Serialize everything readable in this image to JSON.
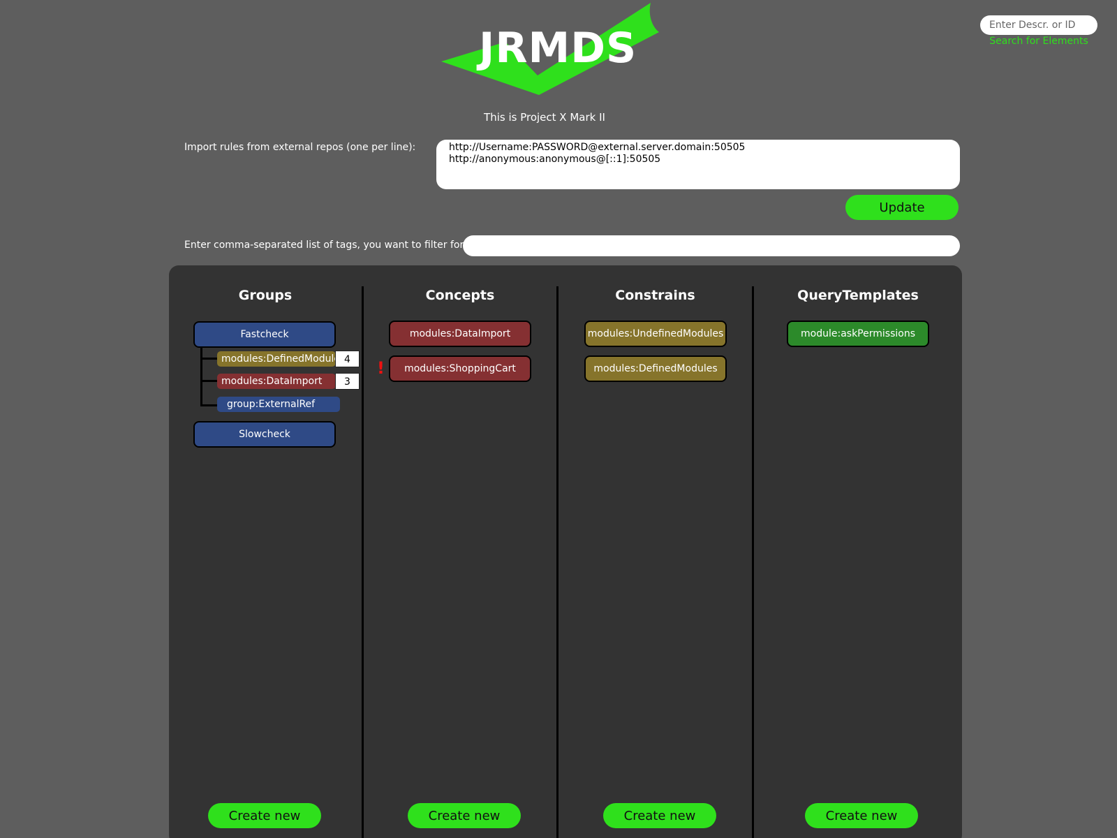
{
  "brand": {
    "logo_text": "JRMDS",
    "accent_color": "#2fe01c"
  },
  "search": {
    "placeholder": "Enter Descr. or ID",
    "link_label": "Search for Elements"
  },
  "subtitle": "This is Project X Mark II",
  "repos": {
    "label": "Import rules from external repos (one per line):",
    "value": "http://Username:PASSWORD@external.server.domain:50505\nhttp://anonymous:anonymous@[::1]:50505",
    "update_label": "Update"
  },
  "tags": {
    "label": "Enter comma-separated list of tags, you want to filter for:",
    "value": ""
  },
  "columns": {
    "groups": {
      "title": "Groups",
      "items": [
        {
          "label": "Fastcheck",
          "color": "#2f4a86"
        },
        {
          "label": "Slowcheck",
          "color": "#2f4a86"
        }
      ],
      "children": [
        {
          "label": "modules:DefinedModules",
          "count": "4",
          "color": "#86742b"
        },
        {
          "label": "modules:DataImport",
          "count": "3",
          "color": "#853032"
        },
        {
          "label": "group:ExternalRef",
          "color": "#2f4a86"
        }
      ],
      "create_label": "Create new"
    },
    "concepts": {
      "title": "Concepts",
      "items": [
        {
          "label": "modules:DataImport",
          "color": "#853032"
        },
        {
          "label": "modules:ShoppingCart",
          "color": "#853032",
          "warning": "!"
        }
      ],
      "create_label": "Create new"
    },
    "constraints": {
      "title": "Constrains",
      "items": [
        {
          "label": "modules:UndefinedModules",
          "color": "#86742b"
        },
        {
          "label": "modules:DefinedModules",
          "color": "#86742b"
        }
      ],
      "create_label": "Create new"
    },
    "querytemplates": {
      "title": "QueryTemplates",
      "items": [
        {
          "label": "module:askPermissions",
          "color": "#2c8a2a"
        }
      ],
      "create_label": "Create new"
    }
  }
}
